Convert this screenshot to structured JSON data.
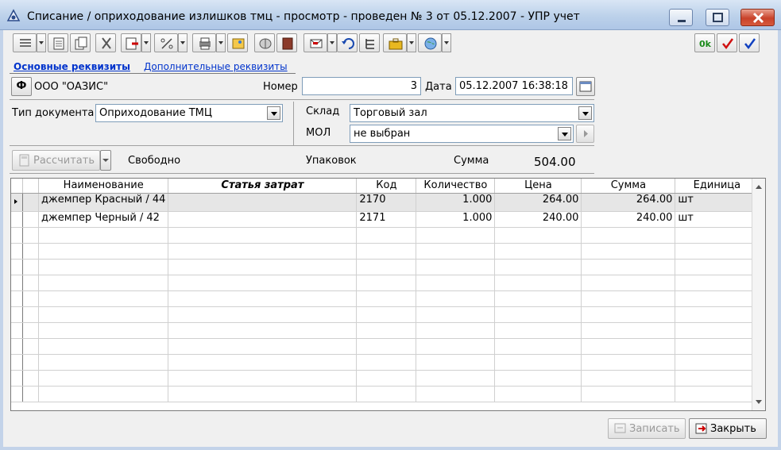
{
  "window": {
    "title": "Списание / оприходование излишков тмц - просмотр - проведен № 3 от 05.12.2007 - УПР учет"
  },
  "toolbar": {
    "icons": [
      "list-icon",
      "form-icon",
      "copy-icon",
      "cut-icon",
      "insert-icon",
      "percent-icon",
      "print-icon",
      "picture-icon",
      "brain-icon",
      "book-icon",
      "envelope-icon",
      "undo-icon",
      "structure-icon",
      "briefcase-icon",
      "globe-icon",
      "ok-icon",
      "checkmark-red-icon",
      "checkmark-blue-icon"
    ],
    "ok_label": "0k"
  },
  "tabs": {
    "main": "Основные реквизиты",
    "additional": "Дополнительные реквизиты"
  },
  "header": {
    "org_button": "Ф",
    "org_name": "ООО \"ОАЗИС\"",
    "number_label": "Номер",
    "number_value": "3",
    "date_label": "Дата",
    "date_value": "05.12.2007 16:38:18",
    "doc_type_label": "Тип документа",
    "doc_type_value": "Оприходование ТМЦ",
    "warehouse_label": "Склад",
    "warehouse_value": "Торговый зал",
    "mol_label": "МОЛ",
    "mol_value": "не выбран"
  },
  "summary": {
    "calc_button": "Рассчитать",
    "free_label": "Свободно",
    "packages_label": "Упаковок",
    "sum_label": "Сумма",
    "sum_value": "504.00"
  },
  "table": {
    "columns": [
      "Наименование",
      "Статья затрат",
      "Код",
      "Количество",
      "Цена",
      "Сумма",
      "Единица"
    ],
    "rows": [
      {
        "name": "джемпер Красный / 44",
        "cost_item": "",
        "code": "2170",
        "qty": "1.000",
        "price": "264.00",
        "sum": "264.00",
        "unit": "шт"
      },
      {
        "name": "джемпер Черный / 42",
        "cost_item": "",
        "code": "2171",
        "qty": "1.000",
        "price": "240.00",
        "sum": "240.00",
        "unit": "шт"
      }
    ]
  },
  "footer": {
    "save_button": "Записать",
    "close_button": "Закрыть"
  }
}
